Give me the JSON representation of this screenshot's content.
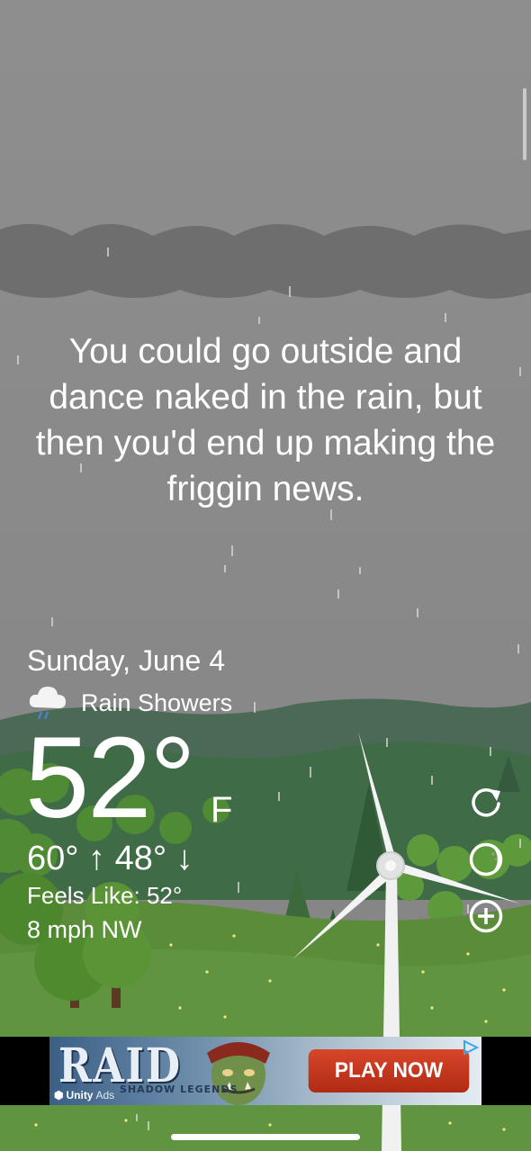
{
  "quote": "You could go outside and dance naked in the rain, but then you'd end up making the friggin news.",
  "weather": {
    "date": "Sunday, June 4",
    "condition": "Rain Showers",
    "condition_icon": "rain-cloud-icon",
    "temperature": "52°",
    "unit": "F",
    "high_low": "60° ↑  48° ↓",
    "feels_like": "Feels Like: 52°",
    "wind": "8 mph NW"
  },
  "controls": [
    "refresh-icon",
    "moon-phase-icon",
    "add-icon"
  ],
  "ad": {
    "game_title": "RAID",
    "game_subtitle": "SHADOW LEGENDS",
    "cta": "PLAY NOW",
    "network": "Unity",
    "network_sub": "Ads"
  },
  "colors": {
    "sky": "#8f8f8f",
    "cloud": "#6f6f6f",
    "hills": "#3f7347",
    "grass": "#5b8c3c",
    "ad_button": "#c8351c"
  }
}
